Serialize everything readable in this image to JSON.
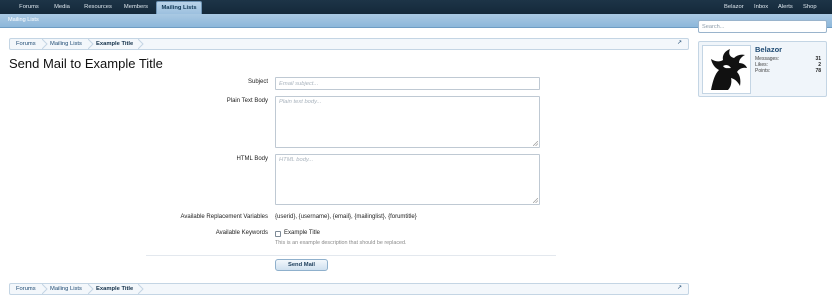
{
  "nav": {
    "tabs": [
      "Forums",
      "Media",
      "Resources",
      "Members",
      "Mailing Lists"
    ],
    "active_tab": "Mailing Lists",
    "right_links": [
      "Belazor",
      "Inbox",
      "Alerts",
      "Shop"
    ],
    "sub_link": "Mailing Lists"
  },
  "search": {
    "placeholder": "Search..."
  },
  "breadcrumb": [
    "Forums",
    "Mailing Lists",
    "Example Title"
  ],
  "page_title": "Send Mail to Example Title",
  "form": {
    "subject_label": "Subject",
    "subject_placeholder": "Email subject...",
    "plain_label": "Plain Text Body",
    "plain_placeholder": "Plain text body...",
    "html_label": "HTML Body",
    "html_placeholder": "HTML body...",
    "vars_label": "Available Replacement Variables",
    "vars_value": "{userid}, {username}, {email}, {mailinglist}, {forumtitle}",
    "keywords_label": "Available Keywords",
    "keyword_option": "Example Title",
    "keyword_desc": "This is an example description that should be replaced.",
    "submit_label": "Send Mail"
  },
  "user_card": {
    "name": "Belazor",
    "stats": [
      {
        "label": "Messages:",
        "value": "31"
      },
      {
        "label": "Likes:",
        "value": "2"
      },
      {
        "label": "Points:",
        "value": "78"
      }
    ]
  },
  "colors": {
    "nav_bg": "#1d3447",
    "sub_nav": "#9cc0df",
    "link": "#1f4b73"
  }
}
